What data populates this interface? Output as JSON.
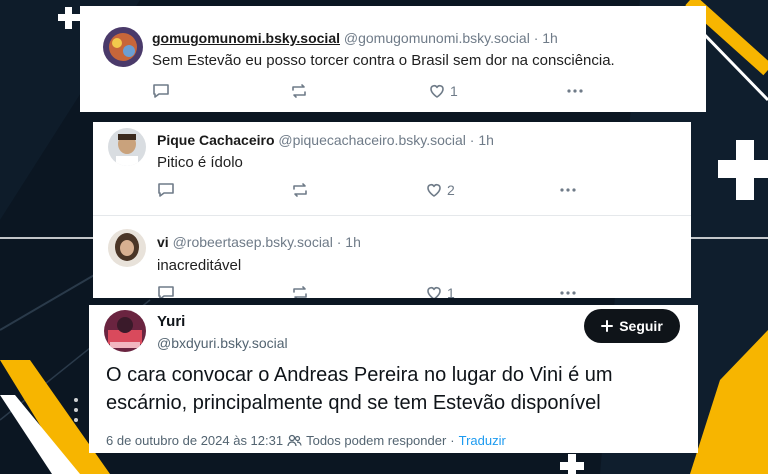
{
  "colors": {
    "background": "#0b1622",
    "accent_yellow": "#f7b500",
    "link": "#1d9bf0",
    "follow_button": "#0f1419"
  },
  "bsky_posts": [
    {
      "name": "gomugomunomi.bsky.social",
      "handle": "@gomugomunomi.bsky.social",
      "sep": "·",
      "time": "1h",
      "text": "Sem Estevão eu posso torcer contra o Brasil sem dor na consciência.",
      "likes": "1",
      "icons": [
        "reply-icon",
        "repost-icon",
        "heart-icon",
        "more-icon"
      ]
    },
    {
      "name": "Pique Cachaceiro",
      "handle": "@piquecachaceiro.bsky.social",
      "sep": "·",
      "time": "1h",
      "text": "Pitico é ídolo",
      "likes": "2",
      "icons": [
        "reply-icon",
        "repost-icon",
        "heart-icon",
        "more-icon"
      ]
    },
    {
      "name": "vi",
      "handle": "@robeertasep.bsky.social",
      "sep": "·",
      "time": "1h",
      "text": "inacreditável",
      "likes": "1",
      "icons": [
        "reply-icon",
        "repost-icon",
        "heart-icon",
        "more-icon"
      ]
    }
  ],
  "tweet": {
    "name": "Yuri",
    "handle": "@bxdyuri.bsky.social",
    "follow_label": "Seguir",
    "text": "O cara convocar o Andreas Pereira no lugar do Vini é um escárnio, principalmente qnd se tem Estevão disponível",
    "date": "6 de outubro de 2024 às 12:31",
    "sep": "·",
    "reply_setting": "Todos podem responder",
    "translate": "Traduzir"
  }
}
